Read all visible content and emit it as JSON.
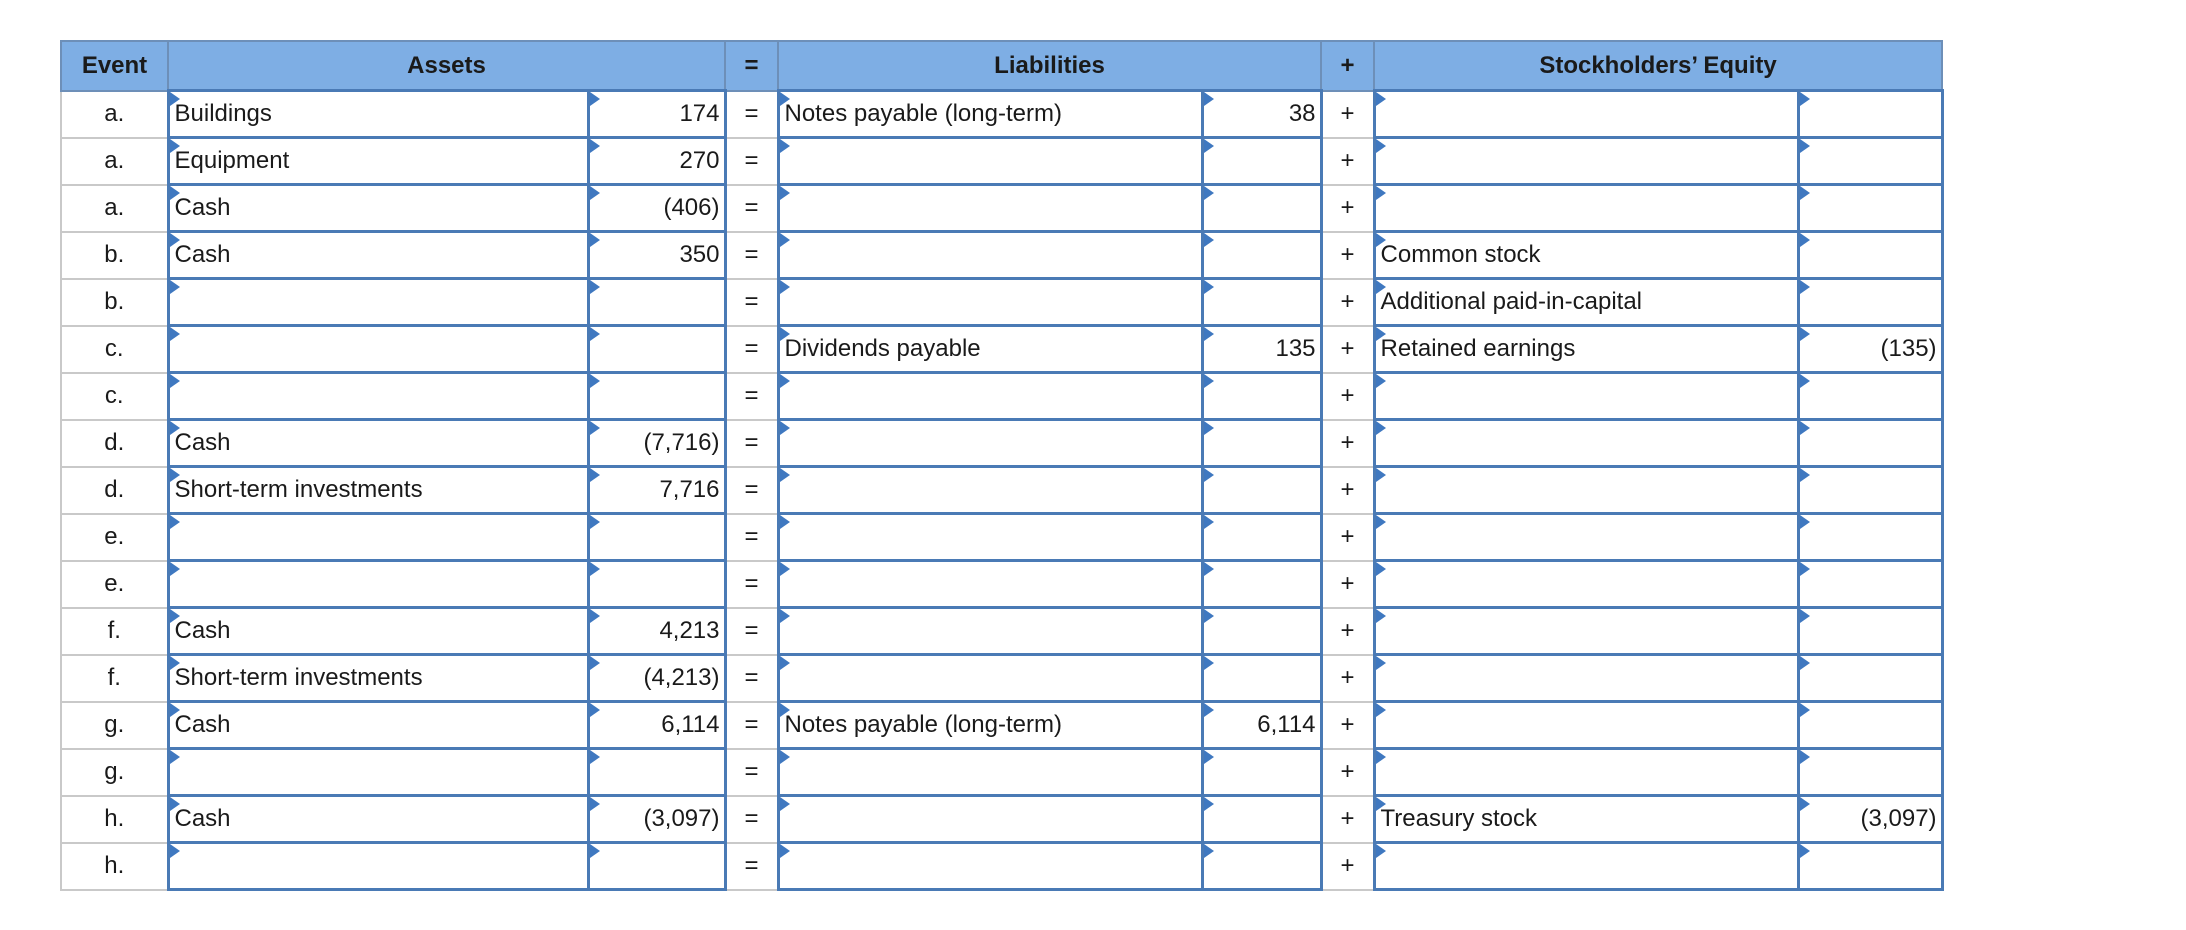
{
  "headers": {
    "event": "Event",
    "assets": "Assets",
    "eq": "=",
    "liabilities": "Liabilities",
    "plus": "+",
    "equity": "Stockholders’ Equity"
  },
  "rows": [
    {
      "event": "a.",
      "asset_label": "Buildings",
      "asset_amount": "174",
      "eq": "=",
      "liab_label": "Notes payable (long-term)",
      "liab_amount": "38",
      "plus": "+",
      "equity_label": "",
      "equity_amount": ""
    },
    {
      "event": "a.",
      "asset_label": "Equipment",
      "asset_amount": "270",
      "eq": "=",
      "liab_label": "",
      "liab_amount": "",
      "plus": "+",
      "equity_label": "",
      "equity_amount": ""
    },
    {
      "event": "a.",
      "asset_label": "Cash",
      "asset_amount": "(406)",
      "eq": "=",
      "liab_label": "",
      "liab_amount": "",
      "plus": "+",
      "equity_label": "",
      "equity_amount": ""
    },
    {
      "event": "b.",
      "asset_label": "Cash",
      "asset_amount": "350",
      "eq": "=",
      "liab_label": "",
      "liab_amount": "",
      "plus": "+",
      "equity_label": "Common stock",
      "equity_amount": ""
    },
    {
      "event": "b.",
      "asset_label": "",
      "asset_amount": "",
      "eq": "=",
      "liab_label": "",
      "liab_amount": "",
      "plus": "+",
      "equity_label": "Additional paid-in-capital",
      "equity_amount": ""
    },
    {
      "event": "c.",
      "asset_label": "",
      "asset_amount": "",
      "eq": "=",
      "liab_label": "Dividends payable",
      "liab_amount": "135",
      "plus": "+",
      "equity_label": "Retained earnings",
      "equity_amount": "(135)"
    },
    {
      "event": "c.",
      "asset_label": "",
      "asset_amount": "",
      "eq": "=",
      "liab_label": "",
      "liab_amount": "",
      "plus": "+",
      "equity_label": "",
      "equity_amount": ""
    },
    {
      "event": "d.",
      "asset_label": "Cash",
      "asset_amount": "(7,716)",
      "eq": "=",
      "liab_label": "",
      "liab_amount": "",
      "plus": "+",
      "equity_label": "",
      "equity_amount": ""
    },
    {
      "event": "d.",
      "asset_label": "Short-term investments",
      "asset_amount": "7,716",
      "eq": "=",
      "liab_label": "",
      "liab_amount": "",
      "plus": "+",
      "equity_label": "",
      "equity_amount": ""
    },
    {
      "event": "e.",
      "asset_label": "",
      "asset_amount": "",
      "eq": "=",
      "liab_label": "",
      "liab_amount": "",
      "plus": "+",
      "equity_label": "",
      "equity_amount": ""
    },
    {
      "event": "e.",
      "asset_label": "",
      "asset_amount": "",
      "eq": "=",
      "liab_label": "",
      "liab_amount": "",
      "plus": "+",
      "equity_label": "",
      "equity_amount": ""
    },
    {
      "event": "f.",
      "asset_label": "Cash",
      "asset_amount": "4,213",
      "eq": "=",
      "liab_label": "",
      "liab_amount": "",
      "plus": "+",
      "equity_label": "",
      "equity_amount": ""
    },
    {
      "event": "f.",
      "asset_label": "Short-term investments",
      "asset_amount": "(4,213)",
      "eq": "=",
      "liab_label": "",
      "liab_amount": "",
      "plus": "+",
      "equity_label": "",
      "equity_amount": ""
    },
    {
      "event": "g.",
      "asset_label": "Cash",
      "asset_amount": "6,114",
      "eq": "=",
      "liab_label": "Notes payable (long-term)",
      "liab_amount": "6,114",
      "plus": "+",
      "equity_label": "",
      "equity_amount": ""
    },
    {
      "event": "g.",
      "asset_label": "",
      "asset_amount": "",
      "eq": "=",
      "liab_label": "",
      "liab_amount": "",
      "plus": "+",
      "equity_label": "",
      "equity_amount": ""
    },
    {
      "event": "h.",
      "asset_label": "Cash",
      "asset_amount": "(3,097)",
      "eq": "=",
      "liab_label": "",
      "liab_amount": "",
      "plus": "+",
      "equity_label": "Treasury stock",
      "equity_amount": "(3,097)"
    },
    {
      "event": "h.",
      "asset_label": "",
      "asset_amount": "",
      "eq": "=",
      "liab_label": "",
      "liab_amount": "",
      "plus": "+",
      "equity_label": "",
      "equity_amount": ""
    }
  ],
  "colors": {
    "header_bg": "#7eaee4",
    "input_border": "#4a7ab5",
    "dropdown_marker": "#3f78c0"
  }
}
